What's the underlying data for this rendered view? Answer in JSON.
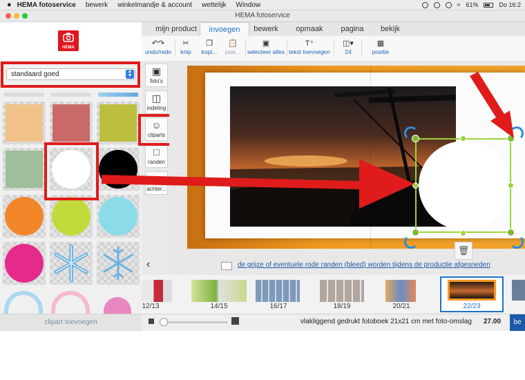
{
  "menubar": {
    "apple": "",
    "app": "HEMA fotoservice",
    "items": [
      "bewerk",
      "winkelmandje & account",
      "wettelijk",
      "Window"
    ],
    "battery": "61%",
    "clock": "Do 16:2"
  },
  "window": {
    "title": "HEMA fotoservice"
  },
  "logo": {
    "text": "HEMA",
    "color": "#e0161e"
  },
  "tabs": [
    {
      "label": "mijn product",
      "active": false
    },
    {
      "label": "invoegen",
      "active": true
    },
    {
      "label": "bewerk",
      "active": false
    },
    {
      "label": "opmaak",
      "active": false
    },
    {
      "label": "pagina",
      "active": false
    },
    {
      "label": "bekijk",
      "active": false
    }
  ],
  "toolbar": {
    "undo_label": "undo/redo",
    "cut_label": "knip",
    "copy_label": "kopi...",
    "paste_label": "plak...",
    "select_all_label": "selecteer alles",
    "add_text_label": "tekst toevoegen",
    "font_size_value": "24",
    "position_label": "positie"
  },
  "clipart_panel": {
    "category_select": "standaard goed",
    "add_button": "clipart toevoegen",
    "items": [
      {
        "name": "peach-square",
        "color": "#f0c28a"
      },
      {
        "name": "rose-square",
        "color": "#c96a6a"
      },
      {
        "name": "olive-square",
        "color": "#bcbf3e"
      },
      {
        "name": "sage-square",
        "color": "#9fbf9c"
      },
      {
        "name": "white-circle",
        "color": "#ffffff"
      },
      {
        "name": "black-circle",
        "color": "#000000"
      },
      {
        "name": "orange-circle",
        "color": "#f4862a"
      },
      {
        "name": "lime-circle",
        "color": "#c3db3a"
      },
      {
        "name": "cyan-circle",
        "color": "#8bdbe8"
      },
      {
        "name": "magenta-circle",
        "color": "#e62a8c"
      },
      {
        "name": "snowflake-1",
        "color": "#6fb3e0"
      },
      {
        "name": "snowflake-2",
        "color": "#6fb3e0"
      }
    ]
  },
  "side_tools": [
    {
      "label": "foto's",
      "icon": "camera-icon"
    },
    {
      "label": "indeling",
      "icon": "layout-icon"
    },
    {
      "label": "cliparts",
      "icon": "smiley-icon"
    },
    {
      "label": "randen",
      "icon": "frame-icon"
    },
    {
      "label": "achter...",
      "icon": "background-icon"
    }
  ],
  "canvas": {
    "bleed_notice": "de grijze of eventuele rode randen (bleed) worden tijdens de productie afgesneden"
  },
  "thumbnails": [
    {
      "label": "12/13",
      "active": false
    },
    {
      "label": "14/15",
      "active": false
    },
    {
      "label": "16/17",
      "active": false
    },
    {
      "label": "18/19",
      "active": false
    },
    {
      "label": "20/21",
      "active": false
    },
    {
      "label": "22/23",
      "active": true
    }
  ],
  "bottom": {
    "book_description": "vlakliggend gedrukt fotoboek 21x21 cm met foto-omslag",
    "price": "27.00",
    "buy_label": "be"
  },
  "colors": {
    "accent_blue": "#1a73c8",
    "highlight_red": "#e01b1b",
    "selection_green": "#9cd43c"
  }
}
